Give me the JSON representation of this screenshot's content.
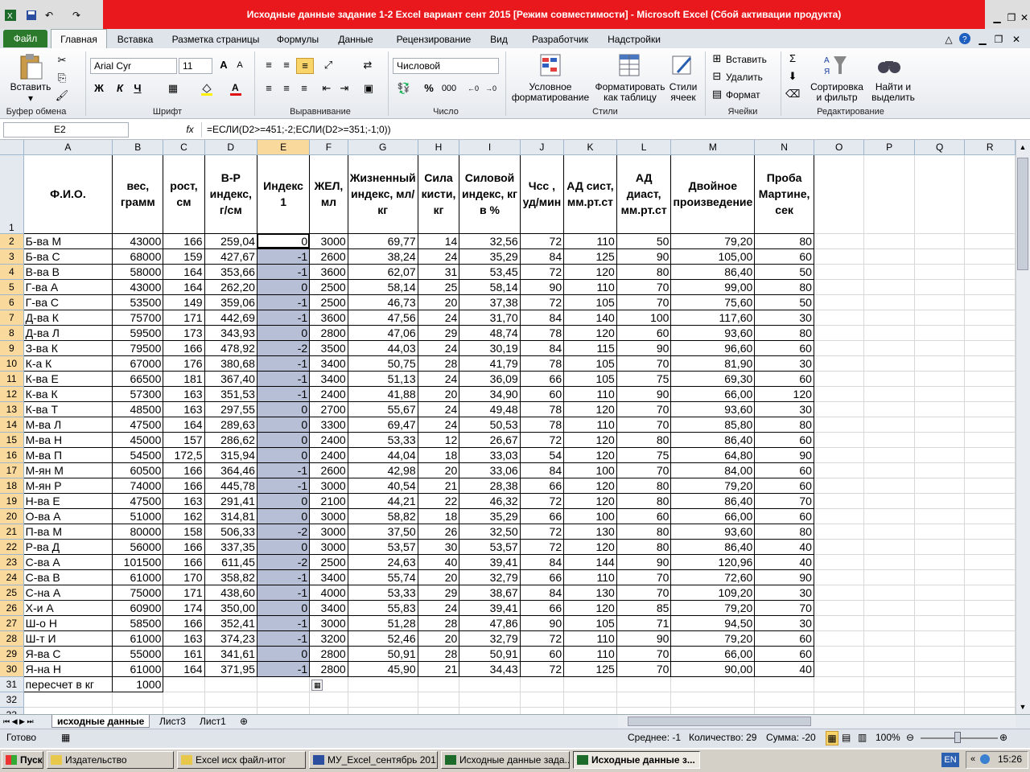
{
  "window": {
    "title": "Исходные данные задание 1-2 Excel вариант сент 2015  [Режим совместимости]  -  Microsoft Excel (Сбой активации продукта)"
  },
  "ribbon": {
    "tabs": [
      "Файл",
      "Главная",
      "Вставка",
      "Разметка страницы",
      "Формулы",
      "Данные",
      "Рецензирование",
      "Вид",
      "Разработчик",
      "Надстройки"
    ],
    "clipboard": {
      "paste": "Вставить",
      "group": "Буфер обмена"
    },
    "font": {
      "name": "Arial Cyr",
      "size": "11",
      "group": "Шрифт",
      "bold": "Ж",
      "italic": "К",
      "underline": "Ч"
    },
    "alignment": {
      "group": "Выравнивание"
    },
    "number": {
      "format": "Числовой",
      "group": "Число",
      "percent": "%",
      "thousands": "000"
    },
    "styles": {
      "conditional": "Условное\nформатирование",
      "as_table": "Форматировать\nкак таблицу",
      "cell_styles": "Стили\nячеек",
      "group": "Стили"
    },
    "cells": {
      "insert": "Вставить",
      "delete": "Удалить",
      "format": "Формат",
      "group": "Ячейки"
    },
    "editing": {
      "sort": "Сортировка\nи фильтр",
      "find": "Найти и\nвыделить",
      "group": "Редактирование"
    }
  },
  "formula_bar": {
    "name_box": "E2",
    "fx": "fx",
    "formula": "=ЕСЛИ(D2>=451;-2;ЕСЛИ(D2>=351;-1;0))"
  },
  "columns": [
    "A",
    "B",
    "C",
    "D",
    "E",
    "F",
    "G",
    "H",
    "I",
    "J",
    "K",
    "L",
    "M",
    "N",
    "O",
    "P",
    "Q",
    "R"
  ],
  "headers": [
    "Ф.И.О.",
    "вес, грамм",
    "рост, см",
    "В-Р индекс, г/см",
    "Индекс 1",
    "ЖЕЛ, мл",
    "Жизненный индекс, мл/кг",
    "Сила кисти, кг",
    "Силовой индекс, кг в %",
    "Чсс , уд/мин",
    "АД сист, мм.рт.ст",
    "АД диаст, мм.рт.ст",
    "Двойное произведение",
    "Проба Мартине, сек"
  ],
  "rows": [
    [
      "Б-ва М",
      "43000",
      "166",
      "259,04",
      "0",
      "3000",
      "69,77",
      "14",
      "32,56",
      "72",
      "110",
      "50",
      "79,20",
      "80"
    ],
    [
      "Б-ва С",
      "68000",
      "159",
      "427,67",
      "-1",
      "2600",
      "38,24",
      "24",
      "35,29",
      "84",
      "125",
      "90",
      "105,00",
      "60"
    ],
    [
      "В-ва В",
      "58000",
      "164",
      "353,66",
      "-1",
      "3600",
      "62,07",
      "31",
      "53,45",
      "72",
      "120",
      "80",
      "86,40",
      "50"
    ],
    [
      "Г-ва А",
      "43000",
      "164",
      "262,20",
      "0",
      "2500",
      "58,14",
      "25",
      "58,14",
      "90",
      "110",
      "70",
      "99,00",
      "80"
    ],
    [
      "Г-ва С",
      "53500",
      "149",
      "359,06",
      "-1",
      "2500",
      "46,73",
      "20",
      "37,38",
      "72",
      "105",
      "70",
      "75,60",
      "50"
    ],
    [
      "Д-ва К",
      "75700",
      "171",
      "442,69",
      "-1",
      "3600",
      "47,56",
      "24",
      "31,70",
      "84",
      "140",
      "100",
      "117,60",
      "30"
    ],
    [
      "Д-ва Л",
      "59500",
      "173",
      "343,93",
      "0",
      "2800",
      "47,06",
      "29",
      "48,74",
      "78",
      "120",
      "60",
      "93,60",
      "80"
    ],
    [
      "З-ва К",
      "79500",
      "166",
      "478,92",
      "-2",
      "3500",
      "44,03",
      "24",
      "30,19",
      "84",
      "115",
      "90",
      "96,60",
      "60"
    ],
    [
      "К-а К",
      "67000",
      "176",
      "380,68",
      "-1",
      "3400",
      "50,75",
      "28",
      "41,79",
      "78",
      "105",
      "70",
      "81,90",
      "30"
    ],
    [
      "К-ва Е",
      "66500",
      "181",
      "367,40",
      "-1",
      "3400",
      "51,13",
      "24",
      "36,09",
      "66",
      "105",
      "75",
      "69,30",
      "60"
    ],
    [
      "К-ва К",
      "57300",
      "163",
      "351,53",
      "-1",
      "2400",
      "41,88",
      "20",
      "34,90",
      "60",
      "110",
      "90",
      "66,00",
      "120"
    ],
    [
      "К-ва Т",
      "48500",
      "163",
      "297,55",
      "0",
      "2700",
      "55,67",
      "24",
      "49,48",
      "78",
      "120",
      "70",
      "93,60",
      "30"
    ],
    [
      "М-ва Л",
      "47500",
      "164",
      "289,63",
      "0",
      "3300",
      "69,47",
      "24",
      "50,53",
      "78",
      "110",
      "70",
      "85,80",
      "80"
    ],
    [
      "М-ва Н",
      "45000",
      "157",
      "286,62",
      "0",
      "2400",
      "53,33",
      "12",
      "26,67",
      "72",
      "120",
      "80",
      "86,40",
      "60"
    ],
    [
      "М-ва П",
      "54500",
      "172,5",
      "315,94",
      "0",
      "2400",
      "44,04",
      "18",
      "33,03",
      "54",
      "120",
      "75",
      "64,80",
      "90"
    ],
    [
      "М-ян М",
      "60500",
      "166",
      "364,46",
      "-1",
      "2600",
      "42,98",
      "20",
      "33,06",
      "84",
      "100",
      "70",
      "84,00",
      "60"
    ],
    [
      "М-ян Р",
      "74000",
      "166",
      "445,78",
      "-1",
      "3000",
      "40,54",
      "21",
      "28,38",
      "66",
      "120",
      "80",
      "79,20",
      "60"
    ],
    [
      "Н-ва Е",
      "47500",
      "163",
      "291,41",
      "0",
      "2100",
      "44,21",
      "22",
      "46,32",
      "72",
      "120",
      "80",
      "86,40",
      "70"
    ],
    [
      "О-ва А",
      "51000",
      "162",
      "314,81",
      "0",
      "3000",
      "58,82",
      "18",
      "35,29",
      "66",
      "100",
      "60",
      "66,00",
      "60"
    ],
    [
      "П-ва М",
      "80000",
      "158",
      "506,33",
      "-2",
      "3000",
      "37,50",
      "26",
      "32,50",
      "72",
      "130",
      "80",
      "93,60",
      "80"
    ],
    [
      "Р-ва Д",
      "56000",
      "166",
      "337,35",
      "0",
      "3000",
      "53,57",
      "30",
      "53,57",
      "72",
      "120",
      "80",
      "86,40",
      "40"
    ],
    [
      "С-ва А",
      "101500",
      "166",
      "611,45",
      "-2",
      "2500",
      "24,63",
      "40",
      "39,41",
      "84",
      "144",
      "90",
      "120,96",
      "40"
    ],
    [
      "С-ва В",
      "61000",
      "170",
      "358,82",
      "-1",
      "3400",
      "55,74",
      "20",
      "32,79",
      "66",
      "110",
      "70",
      "72,60",
      "90"
    ],
    [
      "С-на А",
      "75000",
      "171",
      "438,60",
      "-1",
      "4000",
      "53,33",
      "29",
      "38,67",
      "84",
      "130",
      "70",
      "109,20",
      "30"
    ],
    [
      "Х-и А",
      "60900",
      "174",
      "350,00",
      "0",
      "3400",
      "55,83",
      "24",
      "39,41",
      "66",
      "120",
      "85",
      "79,20",
      "70"
    ],
    [
      "Ш-о Н",
      "58500",
      "166",
      "352,41",
      "-1",
      "3000",
      "51,28",
      "28",
      "47,86",
      "90",
      "105",
      "71",
      "94,50",
      "30"
    ],
    [
      "Ш-т И",
      "61000",
      "163",
      "374,23",
      "-1",
      "3200",
      "52,46",
      "20",
      "32,79",
      "72",
      "110",
      "90",
      "79,20",
      "60"
    ],
    [
      "Я-ва С",
      "55000",
      "161",
      "341,61",
      "0",
      "2800",
      "50,91",
      "28",
      "50,91",
      "60",
      "110",
      "70",
      "66,00",
      "60"
    ],
    [
      "Я-на Н",
      "61000",
      "164",
      "371,95",
      "-1",
      "2800",
      "45,90",
      "21",
      "34,43",
      "72",
      "125",
      "70",
      "90,00",
      "40"
    ]
  ],
  "row31": {
    "label": "пересчет в кг",
    "value": "1000"
  },
  "sheet_tabs": [
    "исходные данные",
    "Лист3",
    "Лист1"
  ],
  "status": {
    "ready": "Готово",
    "average": "Среднее: -1",
    "count": "Количество: 29",
    "sum": "Сумма: -20",
    "zoom": "100%"
  },
  "taskbar": {
    "start": "Пуск",
    "items": [
      "Издательство",
      "Excel исх файл-итог",
      "МУ_Excel_сентябрь 201...",
      "Исходные данные зада...",
      "Исходные данные з..."
    ],
    "lang": "EN",
    "time": "15:26"
  }
}
